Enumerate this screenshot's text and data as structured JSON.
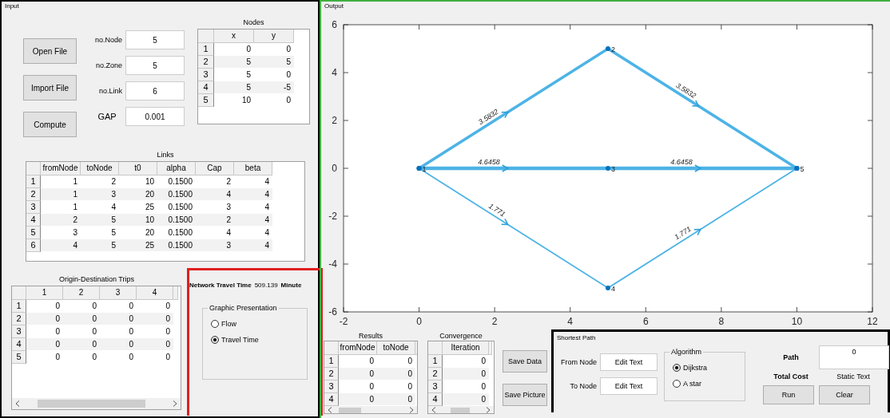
{
  "input_panel": {
    "title": "Input",
    "buttons": [
      {
        "label": "Open File"
      },
      {
        "label": "Import File"
      },
      {
        "label": "Compute"
      }
    ],
    "fields": [
      {
        "label": "no.Node",
        "value": "5"
      },
      {
        "label": "no.Zone",
        "value": "5"
      },
      {
        "label": "no.Link",
        "value": "6"
      },
      {
        "label": "GAP",
        "value": "0.001"
      }
    ],
    "nodes_table": {
      "title": "Nodes",
      "columns": [
        "x",
        "y"
      ],
      "rows": [
        {
          "header": "1",
          "cells": [
            "0",
            "0"
          ]
        },
        {
          "header": "2",
          "cells": [
            "5",
            "5"
          ]
        },
        {
          "header": "3",
          "cells": [
            "5",
            "0"
          ]
        },
        {
          "header": "4",
          "cells": [
            "5",
            "-5"
          ]
        },
        {
          "header": "5",
          "cells": [
            "10",
            "0"
          ]
        }
      ]
    },
    "links_table": {
      "title": "Links",
      "columns": [
        "fromNode",
        "toNode",
        "t0",
        "alpha",
        "Cap",
        "beta"
      ],
      "rows": [
        {
          "header": "1",
          "cells": [
            "1",
            "2",
            "10",
            "0.1500",
            "2",
            "4"
          ]
        },
        {
          "header": "2",
          "cells": [
            "1",
            "3",
            "20",
            "0.1500",
            "4",
            "4"
          ]
        },
        {
          "header": "3",
          "cells": [
            "1",
            "4",
            "25",
            "0.1500",
            "3",
            "4"
          ]
        },
        {
          "header": "4",
          "cells": [
            "2",
            "5",
            "10",
            "0.1500",
            "2",
            "4"
          ]
        },
        {
          "header": "5",
          "cells": [
            "3",
            "5",
            "20",
            "0.1500",
            "4",
            "4"
          ]
        },
        {
          "header": "6",
          "cells": [
            "4",
            "5",
            "25",
            "0.1500",
            "3",
            "4"
          ]
        }
      ]
    },
    "od_table": {
      "title": "Origin-Destination Trips",
      "columns": [
        "1",
        "2",
        "3",
        "4"
      ],
      "rows": [
        {
          "header": "1",
          "cells": [
            "0",
            "0",
            "0",
            "0"
          ]
        },
        {
          "header": "2",
          "cells": [
            "0",
            "0",
            "0",
            "0"
          ]
        },
        {
          "header": "3",
          "cells": [
            "0",
            "0",
            "0",
            "0"
          ]
        },
        {
          "header": "4",
          "cells": [
            "0",
            "0",
            "0",
            "0"
          ]
        },
        {
          "header": "5",
          "cells": [
            "0",
            "0",
            "0",
            "0"
          ]
        }
      ]
    },
    "summary": {
      "label": "Network Travel Time",
      "value": "509.139",
      "unit": "Minute"
    },
    "graphic_presentation": {
      "title": "Graphic Presentation",
      "options": [
        {
          "label": "Flow",
          "selected": false
        },
        {
          "label": "Travel Time",
          "selected": true
        }
      ]
    }
  },
  "output_panel": {
    "title": "Output",
    "chart_data": {
      "type": "line",
      "xlim": [
        -2,
        12
      ],
      "ylim": [
        -6,
        6
      ],
      "xticks": [
        -2,
        0,
        2,
        4,
        6,
        8,
        10,
        12
      ],
      "yticks": [
        -6,
        -4,
        -2,
        0,
        2,
        4,
        6
      ],
      "x": [
        0,
        5,
        10
      ],
      "series": [
        {
          "color": "#4db3e6",
          "marker": "circle",
          "values": [
            0,
            5,
            0
          ]
        },
        {
          "color": "#4db3e6",
          "marker": "circle",
          "values": [
            0,
            0,
            0
          ]
        },
        {
          "color": "#4db3e6",
          "marker": "circle",
          "values": [
            0,
            -5,
            0
          ]
        }
      ],
      "annotations": [
        {
          "x": 2.35,
          "y": 2.35,
          "text": "3.5832"
        },
        {
          "x": 7.4,
          "y": 2.6,
          "text": "3.5832"
        },
        {
          "x": 2.35,
          "y": 0,
          "text": "4.6458"
        },
        {
          "x": 7.45,
          "y": 0,
          "text": "4.6458"
        },
        {
          "x": 2.35,
          "y": -2.35,
          "text": "1.771"
        },
        {
          "x": 7.45,
          "y": -2.55,
          "text": "1.771"
        },
        {
          "x": 0,
          "y": 0,
          "text": "1"
        },
        {
          "x": 5,
          "y": 5,
          "text": "2"
        },
        {
          "x": 5,
          "y": 0,
          "text": "3"
        },
        {
          "x": 5,
          "y": -5,
          "text": "4"
        },
        {
          "x": 10,
          "y": 0,
          "text": "5"
        }
      ]
    },
    "results_table": {
      "title": "Results",
      "columns": [
        "fromNode",
        "toNode"
      ],
      "rows": [
        {
          "header": "1",
          "cells": [
            "0",
            "0"
          ]
        },
        {
          "header": "2",
          "cells": [
            "0",
            "0"
          ]
        },
        {
          "header": "3",
          "cells": [
            "0",
            "0"
          ]
        },
        {
          "header": "4",
          "cells": [
            "0",
            "0"
          ]
        }
      ]
    },
    "convergence_table": {
      "title": "Convergence",
      "columns": [
        "Iteration"
      ],
      "rows": [
        {
          "header": "1",
          "cells": [
            "0"
          ]
        },
        {
          "header": "2",
          "cells": [
            "0"
          ]
        },
        {
          "header": "3",
          "cells": [
            "0"
          ]
        },
        {
          "header": "4",
          "cells": [
            "0"
          ]
        }
      ]
    },
    "buttons": [
      {
        "label": "Save Data"
      },
      {
        "label": "Save Picture"
      }
    ],
    "shortest_path": {
      "title": "Shortest Path",
      "from_node": {
        "label": "From Node",
        "value": "Edit Text"
      },
      "to_node": {
        "label": "To Node",
        "value": "Edit Text"
      },
      "algorithm": {
        "title": "Algorithm",
        "options": [
          {
            "label": "Dijkstra",
            "selected": true
          },
          {
            "label": "A star",
            "selected": false
          }
        ]
      },
      "path": {
        "label": "Path",
        "value": "0"
      },
      "total_cost": {
        "label": "Total Cost",
        "value": "Static Text"
      },
      "buttons": [
        {
          "label": "Run"
        },
        {
          "label": "Clear"
        }
      ]
    }
  }
}
